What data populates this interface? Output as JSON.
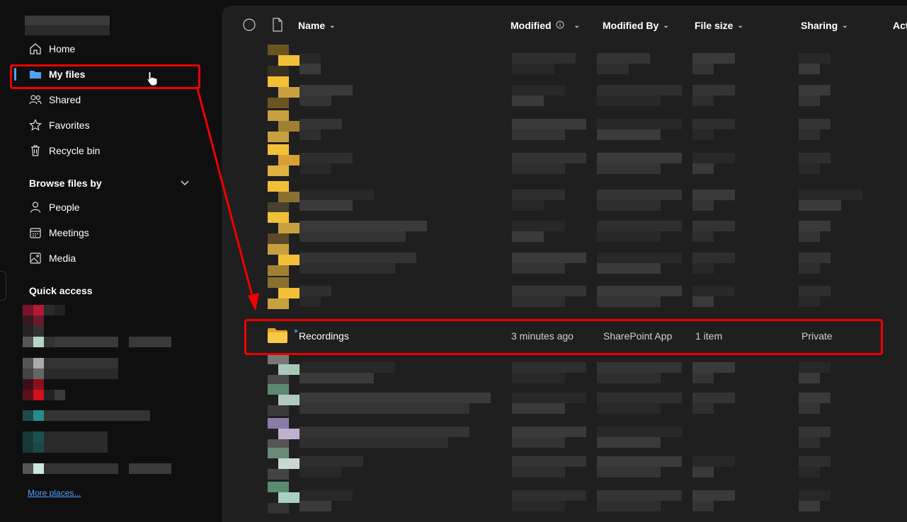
{
  "sidebar": {
    "nav": [
      {
        "label": "Home",
        "icon": "home-icon"
      },
      {
        "label": "My files",
        "icon": "folder-icon"
      },
      {
        "label": "Shared",
        "icon": "people-icon"
      },
      {
        "label": "Favorites",
        "icon": "star-icon"
      },
      {
        "label": "Recycle bin",
        "icon": "trash-icon"
      }
    ],
    "browse_heading": "Browse files by",
    "browse": [
      {
        "label": "People",
        "icon": "person-icon"
      },
      {
        "label": "Meetings",
        "icon": "calendar-icon"
      },
      {
        "label": "Media",
        "icon": "image-icon"
      }
    ],
    "quick_access_heading": "Quick access",
    "more_places": "More places..."
  },
  "columns": {
    "name": "Name",
    "modified": "Modified",
    "modified_by": "Modified By",
    "file_size": "File size",
    "sharing": "Sharing",
    "activity": "Act"
  },
  "highlighted_row": {
    "name": "Recordings",
    "modified": "3 minutes ago",
    "modified_by": "SharePoint App",
    "file_size": "1 item",
    "sharing": "Private"
  },
  "colors": {
    "accent": "#4da3ff",
    "annotation": "#e00000",
    "folder": "#f2c037"
  }
}
